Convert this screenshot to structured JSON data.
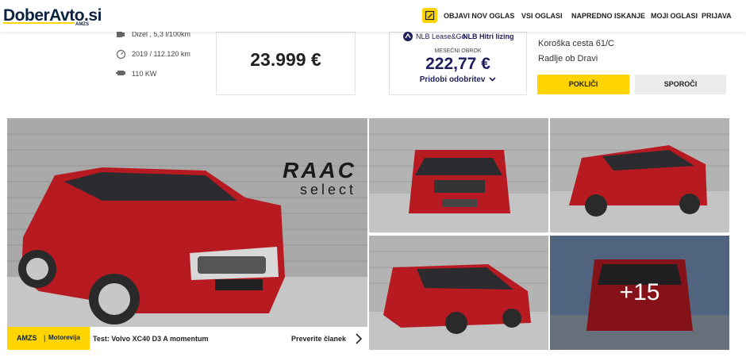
{
  "header": {
    "logo_main": "DoberAvto.si",
    "logo_sub": "AMZS",
    "nav": [
      "OBJAVI NOV OGLAS",
      "VSI OGLASI",
      "NAPREDNO ISKANJE",
      "MOJI OGLASI",
      "PRIJAVA"
    ]
  },
  "specs": {
    "fuel": "Dizel , 5,3 l/100km",
    "year_km": "2019 / 112.120 km",
    "power": "110 KW"
  },
  "price": "23.999 €",
  "loan": {
    "brand": "NLB Lease&Go",
    "brand_name": "NLB Hitri lizing",
    "monthly_label": "MESEČNI OBROK",
    "monthly_value": "222,77 €",
    "link": "Pridobi odobritev"
  },
  "seller": {
    "street": "Koroška cesta 61/C",
    "city": "Radlje ob Dravi",
    "call_label": "POKLIČI",
    "report_label": "SPOROČI"
  },
  "gallery": {
    "more_count": "+15",
    "watermark_top": "RAAC",
    "watermark_bottom": "select"
  },
  "banner": {
    "brand": "AMZS",
    "section": "Motorevija",
    "title": "Test: Volvo XC40 D3 A momentum",
    "link": "Preverite članek"
  },
  "colors": {
    "accent": "#ffd400",
    "navy": "#1f1e5c",
    "car_red": "#b81a22"
  }
}
